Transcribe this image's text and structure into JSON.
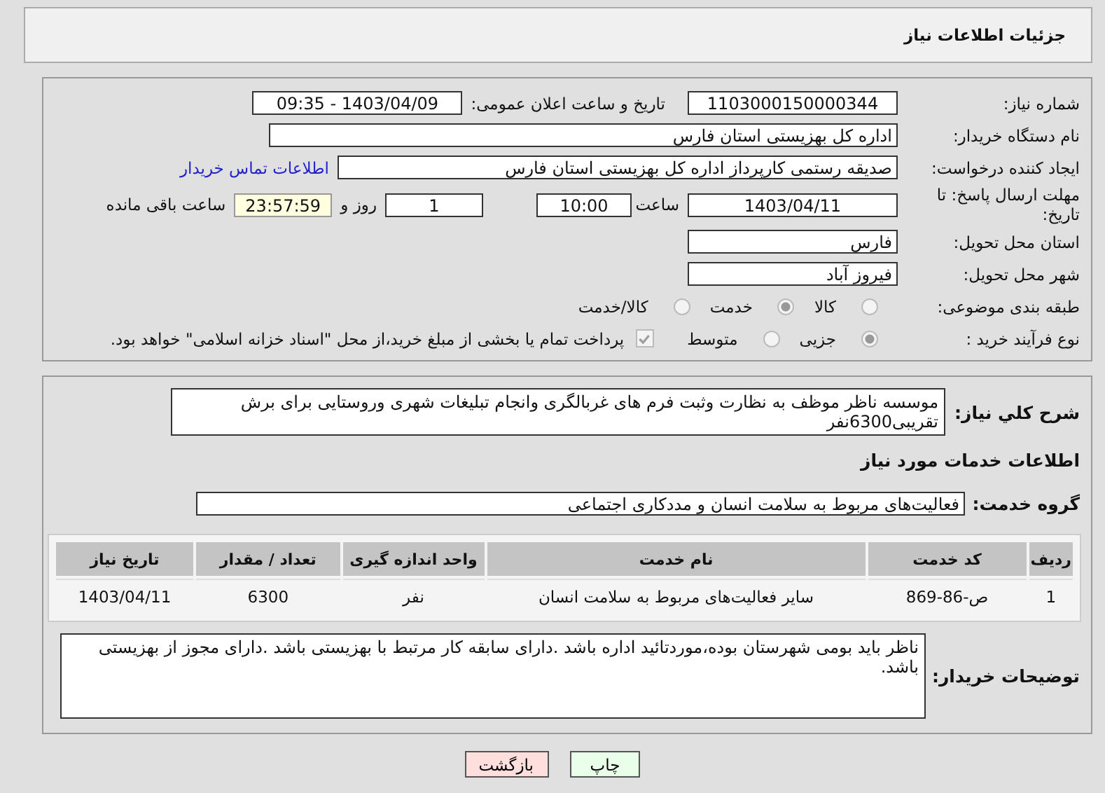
{
  "header": {
    "title": "جزئیات اطلاعات نیاز"
  },
  "details": {
    "need_number": {
      "label": "شماره نیاز:",
      "value": "1103000150000344"
    },
    "announce": {
      "label": "تاریخ و ساعت اعلان عمومی:",
      "value": "1403/04/09 - 09:35"
    },
    "buyer": {
      "label": "نام دستگاه خریدار:",
      "value": "اداره کل بهزیستی استان فارس"
    },
    "creator": {
      "label": "ایجاد کننده درخواست:",
      "value": "صدیقه رستمی کارپرداز اداره کل بهزیستی استان فارس",
      "link": "اطلاعات تماس خریدار"
    },
    "deadline": {
      "label": "مهلت ارسال پاسخ: تا تاریخ:",
      "date": "1403/04/11",
      "time_label": "ساعت",
      "time": "10:00",
      "days": "1",
      "days_label": "روز و",
      "remaining": "23:57:59",
      "remaining_label": "ساعت باقی مانده"
    },
    "province": {
      "label": "استان محل تحویل:",
      "value": "فارس"
    },
    "city": {
      "label": "شهر محل تحویل:",
      "value": "فیروز آباد"
    },
    "category": {
      "label": "طبقه بندی موضوعی:",
      "options": [
        {
          "label": "کالا",
          "selected": false
        },
        {
          "label": "خدمت",
          "selected": true
        },
        {
          "label": "کالا/خدمت",
          "selected": false
        }
      ]
    },
    "process": {
      "label": "نوع فرآیند خرید :",
      "options": [
        {
          "label": "جزیی",
          "selected": true
        },
        {
          "label": "متوسط",
          "selected": false
        }
      ],
      "payment": {
        "label": "پرداخت تمام یا بخشی از مبلغ خرید،از محل \"اسناد خزانه اسلامی\" خواهد بود.",
        "checked": true
      }
    }
  },
  "services": {
    "summary": {
      "label": "شرح کلي نياز:",
      "value": "موسسه ناظر موظف به نظارت وثبت فرم های غربالگری وانجام تبلیغات شهری وروستایی برای برش تقریبی6300نفر"
    },
    "heading": "اطلاعات خدمات مورد نیاز",
    "group": {
      "label": "گروه خدمت:",
      "value": "فعالیت‌های مربوط به سلامت انسان و مددکاری اجتماعی"
    },
    "table": {
      "columns": [
        "ردیف",
        "کد خدمت",
        "نام خدمت",
        "واحد اندازه گیری",
        "تعداد / مقدار",
        "تاریخ نیاز"
      ],
      "rows": [
        [
          "1",
          "ص-86-869",
          "سایر فعالیت‌های مربوط به سلامت انسان",
          "نفر",
          "6300",
          "1403/04/11"
        ]
      ]
    },
    "notes": {
      "label": "توضیحات خریدار:",
      "value": "ناظر باید بومی شهرستان بوده،موردتائید اداره باشد .دارای سابقه کار مرتبط با بهزیستی باشد .دارای مجوز از بهزیستی باشد."
    }
  },
  "buttons": [
    {
      "label": "چاپ",
      "kind": "print"
    },
    {
      "label": "بازگشت",
      "kind": "back"
    }
  ]
}
